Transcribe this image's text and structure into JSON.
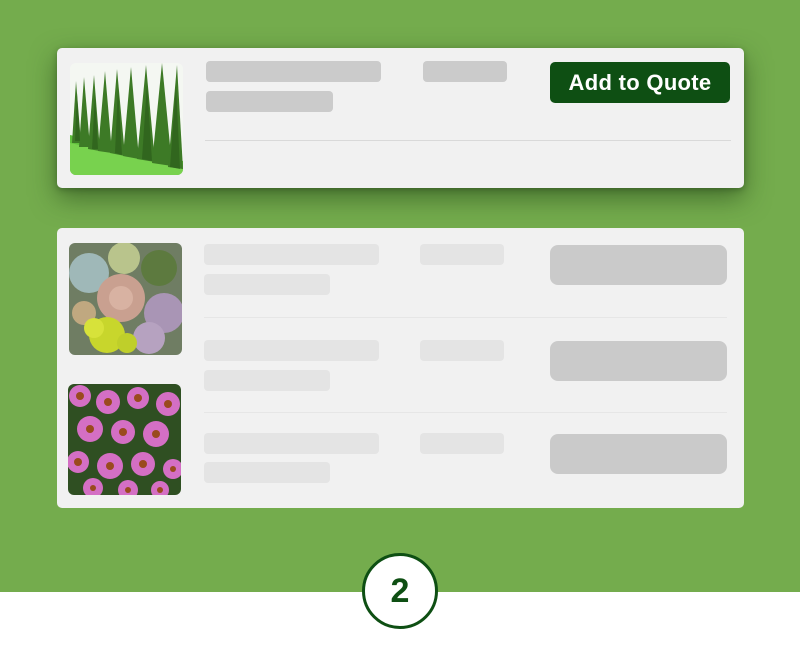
{
  "colors": {
    "background_green": "#74ac4d",
    "card_background": "#f1f1f1",
    "button_green": "#0e4f13",
    "skeleton_dark": "#cbcbcb",
    "skeleton_light": "#e4e4e4"
  },
  "selected_item": {
    "image": "arborvitae-hedge-photo",
    "button_label": "Add to Quote"
  },
  "list_items": [
    {
      "image": "succulents-photo"
    },
    {
      "image": null
    },
    {
      "image": "echinacea-coneflowers-photo"
    }
  ],
  "step": {
    "number": "2"
  }
}
